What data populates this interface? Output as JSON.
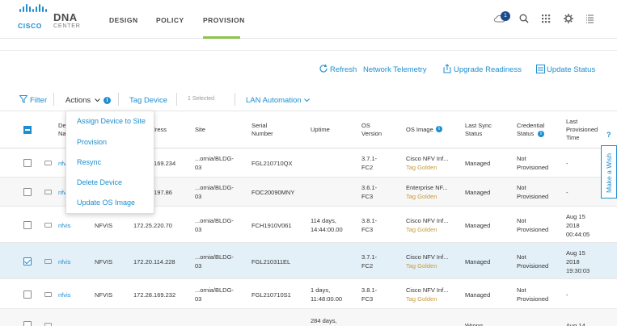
{
  "brand": {
    "company": "CISCO",
    "product": "DNA",
    "product_sub": "CENTER",
    "accent_color": "#1d8ecf",
    "active_underline_color": "#8bc34a"
  },
  "nav": {
    "items": [
      {
        "label": "DESIGN"
      },
      {
        "label": "POLICY"
      },
      {
        "label": "PROVISION"
      }
    ],
    "active": "PROVISION"
  },
  "header_icons": {
    "notifications": {
      "icon": "cloud-bell-icon",
      "count": "1"
    },
    "search": {
      "icon": "search-icon"
    },
    "apps": {
      "icon": "apps-grid-icon"
    },
    "settings": {
      "icon": "gear-icon"
    },
    "menu": {
      "icon": "list-menu-icon"
    }
  },
  "actionbar": {
    "refresh": "Refresh",
    "network_telemetry": "Network Telemetry",
    "upgrade_readiness": "Upgrade Readiness",
    "update_status": "Update Status"
  },
  "toolbar": {
    "filter": "Filter",
    "actions": "Actions",
    "tag_device": "Tag Device",
    "selected": "1 Selected",
    "lan_automation": "LAN Automation"
  },
  "dropdown": {
    "items": [
      "Assign Device to Site",
      "Provision",
      "Resync",
      "Delete Device",
      "Update OS Image"
    ]
  },
  "table": {
    "headers": {
      "device_name": "Device Name",
      "address": "Address",
      "site": "Site",
      "serial": "Serial Number",
      "uptime": "Uptime",
      "os_version": "OS Version",
      "os_image": "OS Image",
      "last_sync": "Last Sync Status",
      "credential": "Credential Status",
      "last_provisioned": "Last Provisioned Time"
    },
    "rows": [
      {
        "name": "nfvis",
        "family": "",
        "ip": "172.28.169.234",
        "site1": "...ornia/BLDG-",
        "site2": "03",
        "serial": "FGL210710QX",
        "up1": "",
        "up2": "",
        "os1": "3.7.1-",
        "os2": "FC2",
        "img": "Cisco NFV Inf...",
        "tag": "Tag Golden",
        "sync": "Managed",
        "cred1": "Not",
        "cred2": "Provisioned",
        "prov1": "-",
        "prov2": "",
        "prov3": "",
        "checked": false
      },
      {
        "name": "nfvis",
        "family": "",
        "ip": "172.25.197.86",
        "site1": "...ornia/BLDG-",
        "site2": "03",
        "serial": "FOC20090MNY",
        "up1": "",
        "up2": "",
        "os1": "3.6.1-",
        "os2": "FC3",
        "img": "Enterprise NF...",
        "tag": "Tag Golden",
        "sync": "Managed",
        "cred1": "Not",
        "cred2": "Provisioned",
        "prov1": "-",
        "prov2": "",
        "prov3": "",
        "checked": false
      },
      {
        "name": "nfvis",
        "family": "NFVIS",
        "ip": "172.25.220.70",
        "site1": "...ornia/BLDG-",
        "site2": "03",
        "serial": "FCH1910V061",
        "up1": "114 days,",
        "up2": "14:44:00.00",
        "os1": "3.8.1-",
        "os2": "FC3",
        "img": "Cisco NFV Inf...",
        "tag": "Tag Golden",
        "sync": "Managed",
        "cred1": "Not",
        "cred2": "Provisioned",
        "prov1": "Aug 15",
        "prov2": "2018",
        "prov3": "00:44:05",
        "checked": false
      },
      {
        "name": "nfvis",
        "family": "NFVIS",
        "ip": "172.20.114.228",
        "site1": "...ornia/BLDG-",
        "site2": "03",
        "serial": "FGL210311EL",
        "up1": "",
        "up2": "",
        "os1": "3.7.1-",
        "os2": "FC2",
        "img": "Cisco NFV Inf...",
        "tag": "Tag Golden",
        "sync": "Managed",
        "cred1": "Not",
        "cred2": "Provisioned",
        "prov1": "Aug 15",
        "prov2": "2018",
        "prov3": "19:30:03",
        "checked": true
      },
      {
        "name": "nfvis",
        "family": "NFVIS",
        "ip": "172.28.169.232",
        "site1": "...ornia/BLDG-",
        "site2": "03",
        "serial": "FGL210710S1",
        "up1": "1 days,",
        "up2": "11:48:00.00",
        "os1": "3.8.1-",
        "os2": "FC3",
        "img": "Cisco NFV Inf...",
        "tag": "Tag Golden",
        "sync": "Managed",
        "cred1": "Not",
        "cred2": "Provisioned",
        "prov1": "-",
        "prov2": "",
        "prov3": "",
        "checked": false
      },
      {
        "name": "",
        "family": "",
        "ip": "",
        "site1": "",
        "site2": "",
        "serial": "",
        "up1": "284 days,",
        "up2": "",
        "os1": "",
        "os2": "",
        "img": "",
        "tag": "",
        "sync": "Wrong",
        "cred1": "",
        "cred2": "",
        "prov1": "Aug 14",
        "prov2": "",
        "prov3": "",
        "checked": false
      }
    ]
  },
  "right_tab": {
    "help": "?",
    "wish": "Make a Wish"
  }
}
